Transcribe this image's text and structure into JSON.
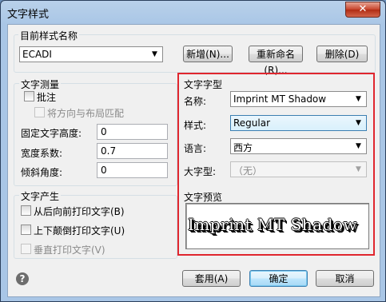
{
  "window": {
    "title": "文字样式",
    "close_icon": "close-icon"
  },
  "current_style": {
    "label": "目前样式名称",
    "value": "ECADI",
    "buttons": {
      "new": "新增(N)...",
      "rename": "重新命名(R)...",
      "delete": "删除(D)"
    }
  },
  "measure": {
    "label": "文字测量",
    "annotative": "批注",
    "match_orientation": "将方向与布局匹配",
    "fixed_height_label": "固定文字高度:",
    "fixed_height_value": "0",
    "width_factor_label": "宽度系数:",
    "width_factor_value": "0.7",
    "oblique_label": "倾斜角度:",
    "oblique_value": "0"
  },
  "generation": {
    "label": "文字产生",
    "backwards": "从后向前打印文字(B)",
    "upside_down": "上下颠倒打印文字(U)",
    "vertical": "垂直打印文字(V)"
  },
  "font": {
    "label": "文字字型",
    "name_label": "名称:",
    "name_value": "Imprint MT Shadow",
    "style_label": "样式:",
    "style_value": "Regular",
    "language_label": "语言:",
    "language_value": "西方",
    "bigfont_label": "大字型:",
    "bigfont_value": "（无）"
  },
  "preview": {
    "label": "文字预览",
    "text": "Imprint MT Shadow"
  },
  "footer": {
    "apply": "套用(A)",
    "ok": "确定",
    "cancel": "取消",
    "help_icon": "help-icon"
  },
  "colors": {
    "highlight_frame": "#e0262e",
    "title_bar": "#a9c6e6"
  }
}
